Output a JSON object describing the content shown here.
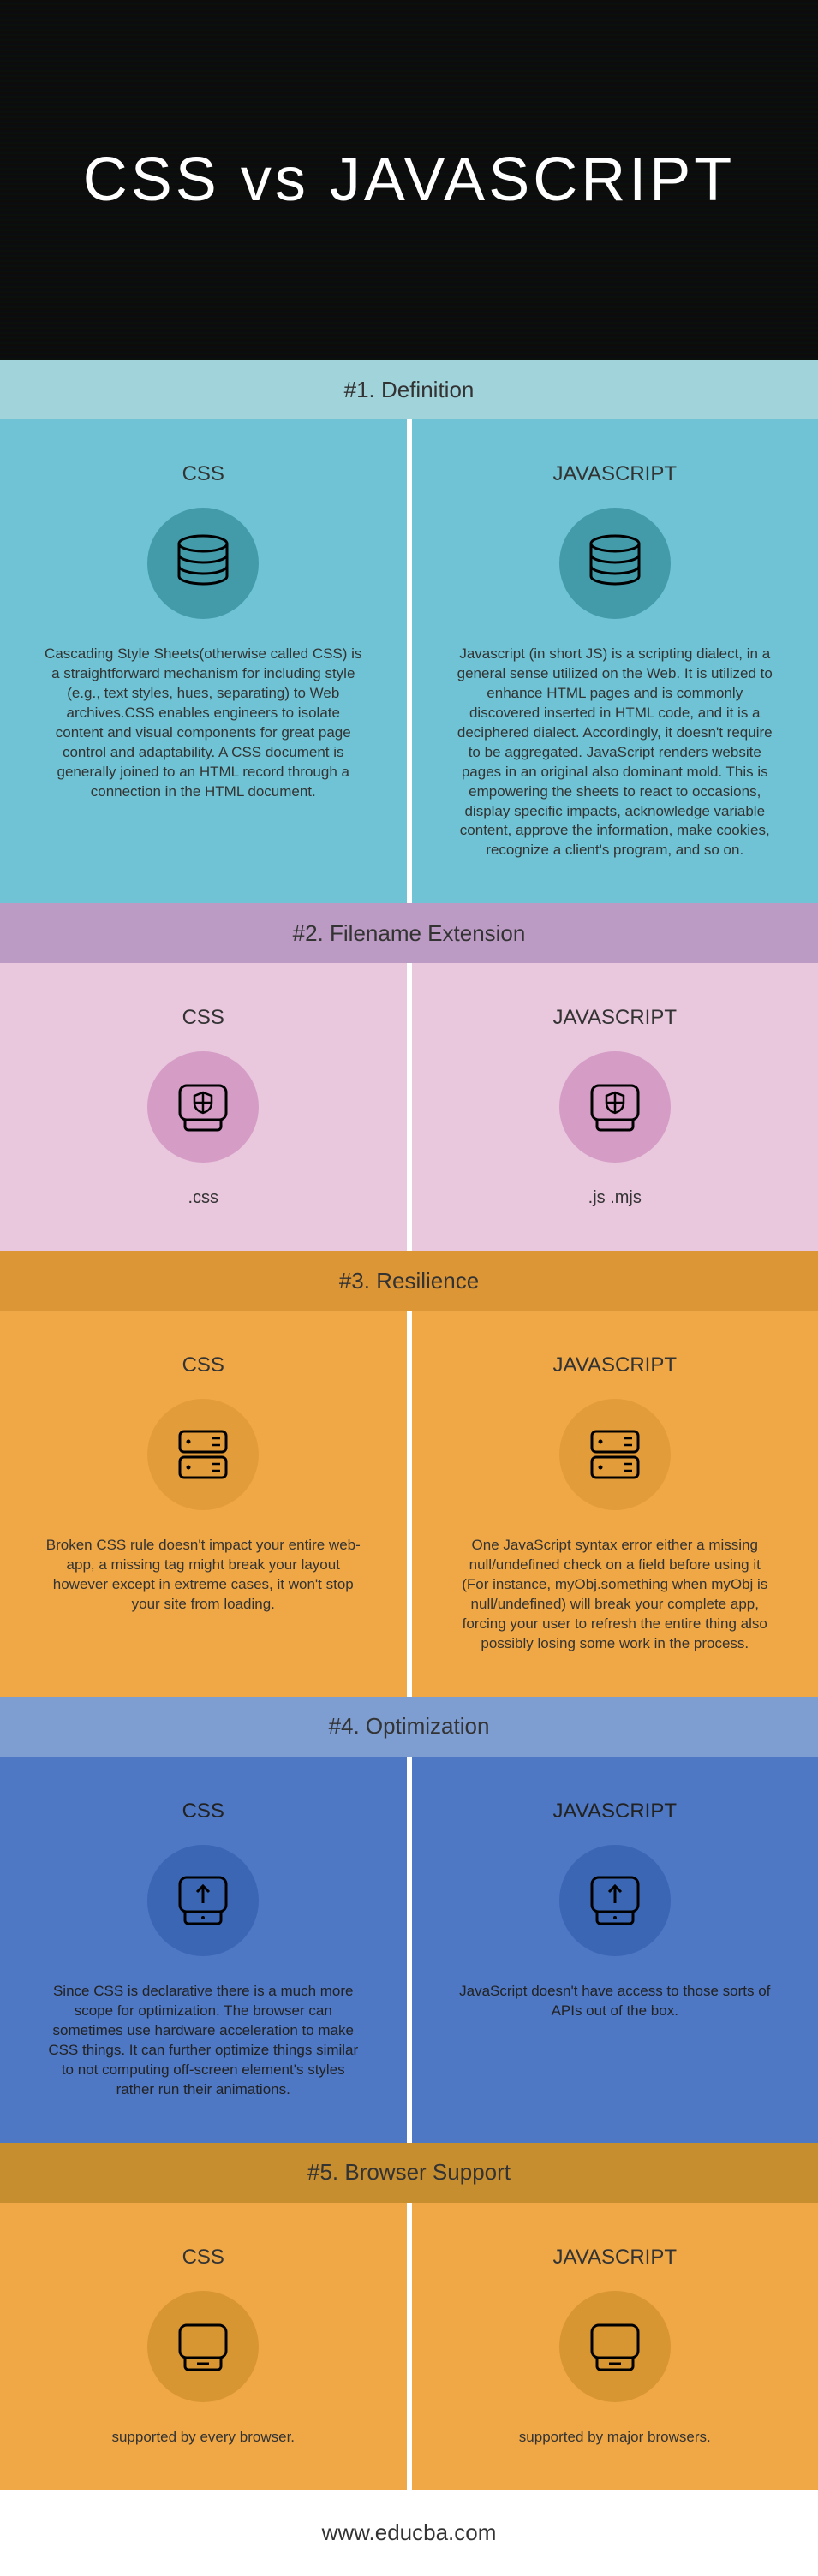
{
  "title": "CSS vs JAVASCRIPT",
  "sections": [
    {
      "header": "#1. Definition",
      "css_title": "CSS",
      "js_title": "JAVASCRIPT",
      "css_body": "Cascading Style Sheets(otherwise called CSS) is a straightforward mechanism for including style (e.g., text styles, hues, separating) to Web archives.CSS enables engineers to isolate content and visual components for great page control and adaptability. A CSS document is generally joined to an HTML record through a connection in the HTML document.",
      "js_body": "Javascript (in short JS) is a scripting dialect, in a general sense utilized on the Web. It is utilized to enhance HTML pages and is commonly discovered inserted in HTML code, and it is a deciphered dialect. Accordingly, it doesn't require to be aggregated. JavaScript renders website pages in an original also dominant mold. This is empowering the sheets to react to occasions, display specific impacts, acknowledge variable content, approve the information, make cookies, recognize a client's program, and so on."
    },
    {
      "header": "#2. Filename Extension",
      "css_title": "CSS",
      "js_title": "JAVASCRIPT",
      "css_ext": ".css",
      "js_ext": ".js .mjs"
    },
    {
      "header": "#3. Resilience",
      "css_title": "CSS",
      "js_title": "JAVASCRIPT",
      "css_body": "Broken CSS rule doesn't impact your entire web-app, a missing tag might break your layout however except in extreme cases, it won't stop your site from loading.",
      "js_body": "One JavaScript syntax error either a missing null/undefined check on a field before using it (For instance, myObj.something when myObj is null/undefined) will break your complete app, forcing your user to refresh the entire thing also possibly losing some work in the process."
    },
    {
      "header": "#4. Optimization",
      "css_title": "CSS",
      "js_title": "JAVASCRIPT",
      "css_body": "Since CSS is declarative there is a much more scope for optimization. The browser can sometimes use hardware acceleration to make CSS things. It can further optimize things similar to not computing off-screen element's styles rather run their animations.",
      "js_body": "JavaScript doesn't have access to those sorts of APIs out of the box."
    },
    {
      "header": "#5. Browser Support",
      "css_title": "CSS",
      "js_title": "JAVASCRIPT",
      "css_body": "supported by every browser.",
      "js_body": "supported by major browsers."
    }
  ],
  "footer": "www.educba.com"
}
